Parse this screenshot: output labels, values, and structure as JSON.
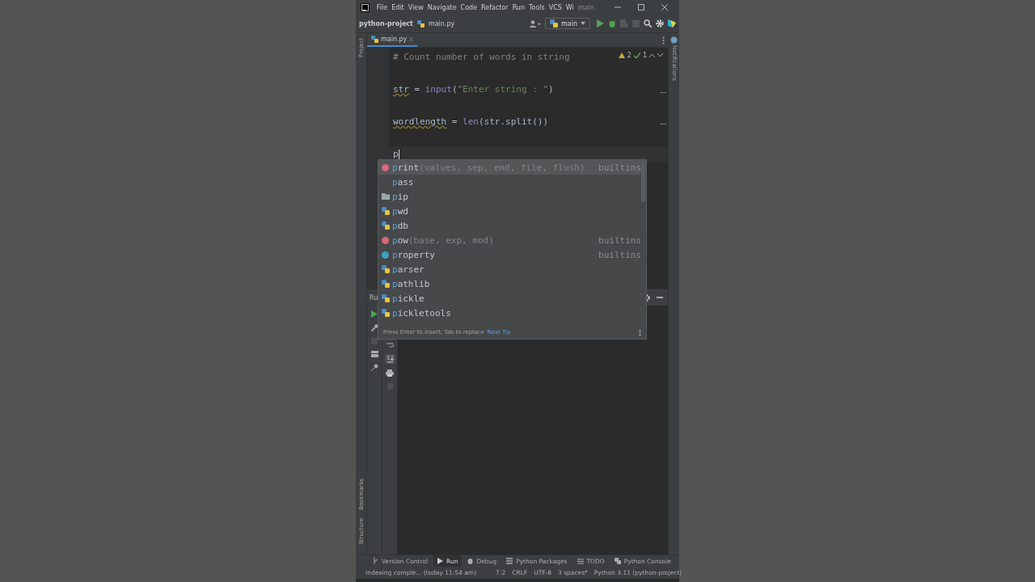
{
  "window": {
    "menu": [
      "File",
      "Edit",
      "View",
      "Navigate",
      "Code",
      "Refactor",
      "Run",
      "Tools",
      "VCS",
      "Wi"
    ],
    "title": "main."
  },
  "breadcrumbs": [
    "python-project",
    "main.py"
  ],
  "run_config": "main",
  "tabs": [
    {
      "label": "main.py",
      "selected": true
    }
  ],
  "inspections": {
    "warnings": "2",
    "ok": "1"
  },
  "left_strip": {
    "top": [
      "Project"
    ],
    "bottom": [
      "Bookmarks",
      "Structure"
    ]
  },
  "right_strip": [
    "Notifications"
  ],
  "code_lines": [
    {
      "tokens": [
        {
          "kind": "comment",
          "text": "# Count number of words in string"
        }
      ]
    },
    {
      "tokens": [
        {
          "kind": "warn",
          "text": "str"
        },
        {
          "kind": "plain",
          "text": " = "
        },
        {
          "kind": "builtin",
          "text": "input"
        },
        {
          "kind": "plain",
          "text": "("
        },
        {
          "kind": "string",
          "text": "\"Enter string : \""
        },
        {
          "kind": "plain",
          "text": ")"
        }
      ]
    },
    {
      "tokens": [
        {
          "kind": "warn",
          "text": "wordlength"
        },
        {
          "kind": "plain",
          "text": " = "
        },
        {
          "kind": "builtin",
          "text": "len"
        },
        {
          "kind": "plain",
          "text": "(str.split())"
        }
      ]
    },
    {
      "tokens": [
        {
          "kind": "plain",
          "text": "p"
        }
      ],
      "caret": true
    }
  ],
  "completion": {
    "items": [
      {
        "kind": "function",
        "match": "p",
        "rest": "rint",
        "signature": "(values, sep, end, file, flush)",
        "source": "builtins",
        "selected": true
      },
      {
        "kind": "keyword",
        "match": "p",
        "rest": "ass",
        "selected": false
      },
      {
        "kind": "package",
        "match": "p",
        "rest": "ip",
        "selected": false
      },
      {
        "kind": "module",
        "match": "p",
        "rest": "wd",
        "selected": false
      },
      {
        "kind": "module",
        "match": "p",
        "rest": "db",
        "selected": false
      },
      {
        "kind": "function",
        "match": "p",
        "rest": "ow",
        "signature": "(base, exp, mod)",
        "source": "builtins",
        "selected": false
      },
      {
        "kind": "class",
        "match": "p",
        "rest": "roperty",
        "source": "builtins",
        "selected": false
      },
      {
        "kind": "module",
        "match": "p",
        "rest": "arser",
        "selected": false
      },
      {
        "kind": "module",
        "match": "p",
        "rest": "athlib",
        "selected": false
      },
      {
        "kind": "module",
        "match": "p",
        "rest": "ickle",
        "selected": false
      },
      {
        "kind": "module",
        "match": "p",
        "rest": "ickletools",
        "selected": false
      }
    ],
    "hint": "Press Enter to insert, Tab to replace",
    "tip_link": "Next Tip"
  },
  "run_panel": {
    "title": "Ru"
  },
  "tool_tabs": [
    {
      "label": "Version Control",
      "kind": "vcs",
      "selected": false
    },
    {
      "label": "Run",
      "kind": "run",
      "selected": true
    },
    {
      "label": "Debug",
      "kind": "debug",
      "selected": false
    },
    {
      "label": "Python Packages",
      "kind": "packages",
      "selected": false
    },
    {
      "label": "TODO",
      "kind": "todo",
      "selected": false
    },
    {
      "label": "Python Console",
      "kind": "console",
      "selected": false
    }
  ],
  "status_bar": [
    "Indexing comple... (today 11:54 am)",
    "7:2",
    "CRLF",
    "UTF-8",
    "3 spaces*",
    "Python 3.11 (python-project)"
  ]
}
